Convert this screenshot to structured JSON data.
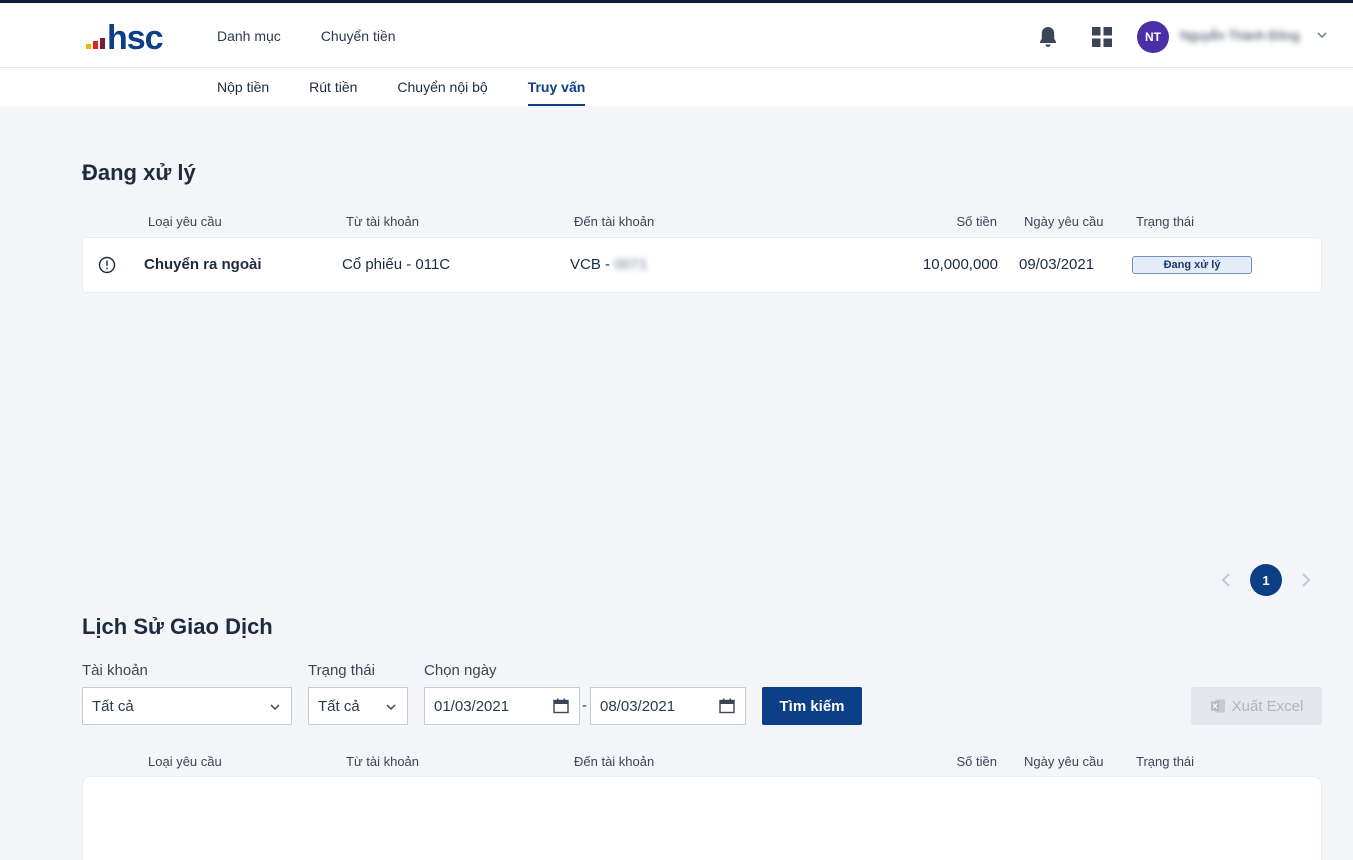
{
  "colors": {
    "brand": "#0c3f85",
    "logo_dots": [
      "#f2b705",
      "#e2231a",
      "#7a1b3a"
    ],
    "avatar": "#4a2fa8",
    "background": "#f3f5f8"
  },
  "header": {
    "logo_text": "hsc",
    "nav": [
      "Danh mục",
      "Chuyển tiền"
    ],
    "avatar_initials": "NT",
    "user_name": "Nguyễn Thành Đông",
    "icons": [
      "bell-icon",
      "grid-icon",
      "chevron-down-icon"
    ]
  },
  "subnav": {
    "tabs": [
      "Nộp tiền",
      "Rút tiền",
      "Chuyển nội bộ",
      "Truy vấn"
    ],
    "active": "Truy vấn"
  },
  "pending": {
    "title": "Đang xử lý",
    "columns": [
      "Loại yêu cầu",
      "Từ tài khoản",
      "Đến tài khoản",
      "Số tiền",
      "Ngày yêu cầu",
      "Trạng thái"
    ],
    "rows": [
      {
        "type": "Chuyển ra ngoài",
        "from": "Cổ phiếu - 011C",
        "to_prefix": "VCB - ",
        "to_masked": "0071",
        "amount": "10,000,000",
        "date": "09/03/2021",
        "status": "Đang xử lý"
      }
    ]
  },
  "pagination": {
    "current": "1"
  },
  "history": {
    "title": "Lịch Sử Giao Dịch",
    "filters": {
      "account_label": "Tài khoản",
      "account_value": "Tất cả",
      "status_label": "Trạng thái",
      "status_value": "Tất cả",
      "date_label": "Chọn ngày",
      "date_from": "01/03/2021",
      "date_sep": "-",
      "date_to": "08/03/2021"
    },
    "search_label": "Tìm kiếm",
    "excel_label": "Xuất Excel",
    "columns": [
      "Loại yêu cầu",
      "Từ tài khoản",
      "Đến tài khoản",
      "Số tiền",
      "Ngày yêu cầu",
      "Trạng thái"
    ]
  }
}
